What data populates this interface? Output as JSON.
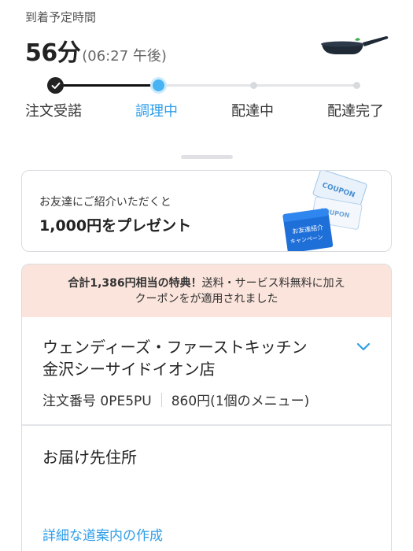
{
  "eta": {
    "label": "到着予定時間",
    "minutes": "56分",
    "clock": "(06:27 午後)"
  },
  "progress": {
    "steps": [
      "注文受諾",
      "調理中",
      "配達中",
      "配達完了"
    ],
    "active_index": 1,
    "colors": {
      "done": "#222222",
      "active": "#47b3f2",
      "todo": "#d8dbde"
    }
  },
  "promo": {
    "subtitle": "お友達にご紹介いただくと",
    "title": "1,000円をプレゼント",
    "art": {
      "coupon_text": "COUPON",
      "campaign_line1": "お友達紹介",
      "campaign_line2": "キャンペーン"
    }
  },
  "order": {
    "banner_bold": "合計1,386円相当の特典！",
    "banner_rest_line1": "送料・サービス料無料に加え",
    "banner_line2": "クーポンをが適用されました",
    "store_line1": "ウェンディーズ・ファーストキッチン",
    "store_line2": "金沢シーサイドイオン店",
    "order_number": "注文番号 0PE5PU",
    "order_summary": "860円(1個のメニュー)",
    "address_title": "お届け先住所",
    "directions_link": "詳細な道案内の作成"
  }
}
